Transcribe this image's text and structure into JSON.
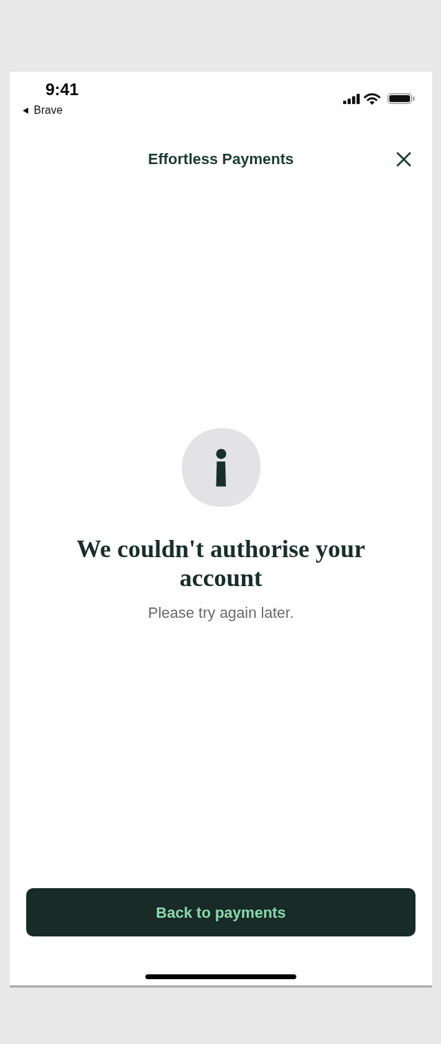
{
  "status_bar": {
    "time": "9:41",
    "back_label": "Brave"
  },
  "header": {
    "title": "Effortless Payments"
  },
  "message": {
    "title": "We couldn't authorise your account",
    "subtitle": "Please try again later."
  },
  "primary_button": {
    "label": "Back to payments"
  }
}
